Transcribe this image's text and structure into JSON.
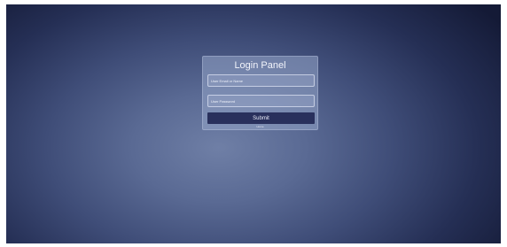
{
  "login_panel": {
    "title": "Login Panel",
    "email_placeholder": "User Email or Name",
    "password_placeholder": "User Password",
    "submit_label": "Submit",
    "footer_link": "Home"
  }
}
